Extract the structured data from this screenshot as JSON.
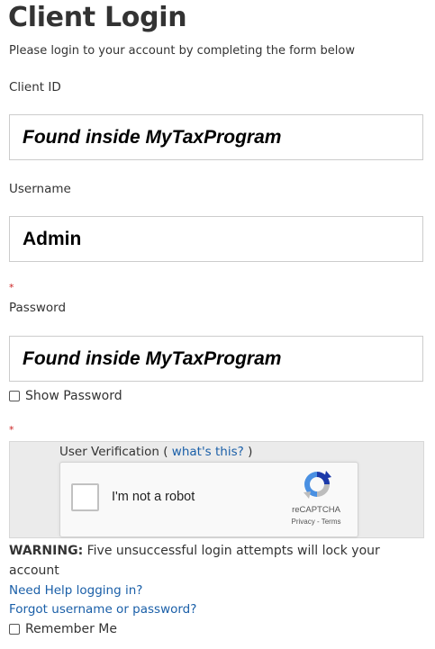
{
  "page": {
    "title": "Client Login",
    "subtitle": "Please login to your account by completing the form below"
  },
  "client_id": {
    "label": "Client ID",
    "value": "Found inside MyTaxProgram"
  },
  "username": {
    "label": "Username",
    "value": "Admin"
  },
  "password": {
    "required_marker": "*",
    "label": "Password",
    "value": "Found inside MyTaxProgram"
  },
  "show_password": {
    "label": "Show Password",
    "checked": false
  },
  "verification": {
    "required_marker": "*",
    "label": "User Verification (",
    "help_link": "what's this?",
    "label_end": ")",
    "recaptcha": {
      "checkbox_label": "I'm not a robot",
      "brand": "reCAPTCHA",
      "terms": "Privacy - Terms",
      "logo_icon": "recaptcha-logo-icon"
    }
  },
  "warning": {
    "prefix": "WARNING:",
    "text": " Five unsuccessful login attempts will lock your account"
  },
  "links": {
    "help": "Need Help logging in?",
    "forgot": "Forgot username or password?"
  },
  "remember_me": {
    "label": "Remember Me",
    "checked": false
  },
  "colors": {
    "link": "#1a5fa8",
    "required": "#cc2222",
    "verification_bg": "#ebebeb"
  }
}
